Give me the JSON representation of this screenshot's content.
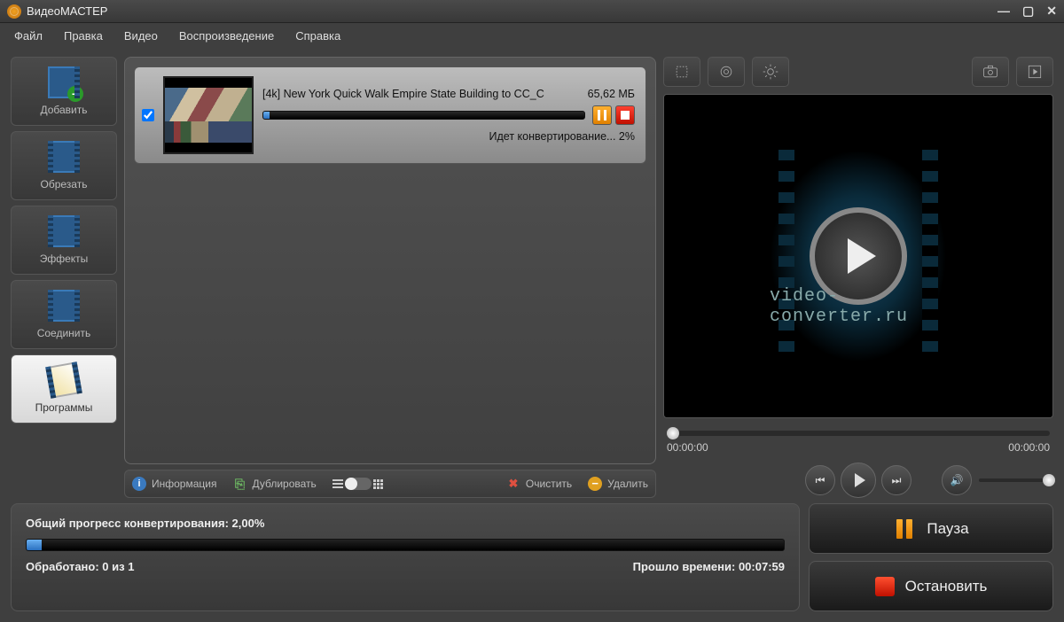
{
  "app": {
    "title": "ВидеоМАСТЕР"
  },
  "menu": [
    "Файл",
    "Правка",
    "Видео",
    "Воспроизведение",
    "Справка"
  ],
  "sidebar": [
    {
      "id": "add",
      "label": "Добавить"
    },
    {
      "id": "cut",
      "label": "Обрезать"
    },
    {
      "id": "fx",
      "label": "Эффекты"
    },
    {
      "id": "join",
      "label": "Соединить"
    },
    {
      "id": "prog",
      "label": "Программы"
    }
  ],
  "queue": {
    "items": [
      {
        "checked": true,
        "title": "[4k] New York Quick Walk Empire State Building to CC_C",
        "size": "65,62 МБ",
        "status": "Идет конвертирование... 2%",
        "progress_pct": 2
      }
    ]
  },
  "centerBar": {
    "info": "Информация",
    "duplicate": "Дублировать",
    "clear": "Очистить",
    "delete": "Удалить"
  },
  "player": {
    "brand": "video-converter.ru",
    "time_start": "00:00:00",
    "time_end": "00:00:00"
  },
  "progress": {
    "title_prefix": "Общий прогресс конвертирования: ",
    "pct_text": "2,00%",
    "processed_label": "Обработано: 0 из 1",
    "elapsed_label": "Прошло времени: 00:07:59"
  },
  "actions": {
    "pause": "Пауза",
    "stop": "Остановить"
  }
}
